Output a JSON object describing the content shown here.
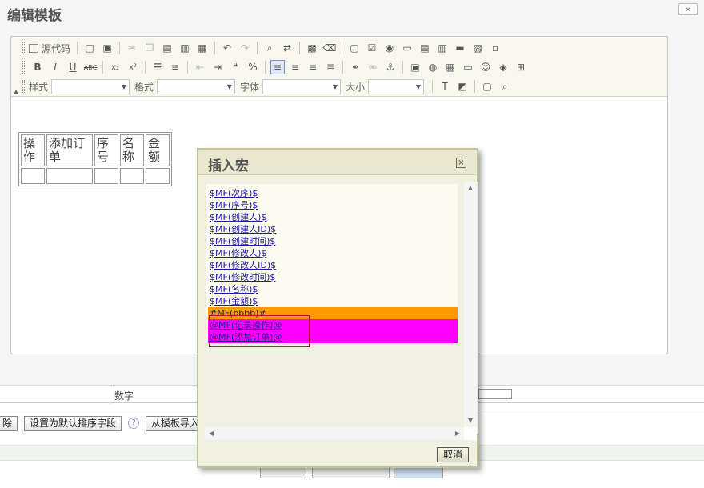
{
  "outer_dialog": {
    "title": "编辑模板",
    "close_icon": "×"
  },
  "toolbar": {
    "source_label": "源代码",
    "style_label": "样式",
    "format_label": "格式",
    "font_label": "字体",
    "size_label": "大小",
    "style_value": "",
    "format_value": "",
    "font_value": "",
    "size_value": ""
  },
  "template_table": {
    "headers": [
      "操作",
      "添加订单",
      "序号",
      "名称",
      "金额"
    ]
  },
  "macro_dialog": {
    "title": "插入宏",
    "items": [
      "$MF(次序)$",
      "$MF(序号)$",
      "$MF(创建人)$",
      "$MF(创建人ID)$",
      "$MF(创建时间)$",
      "$MF(修改人)$",
      "$MF(修改人ID)$",
      "$MF(修改时间)$",
      "$MF(名称)$",
      "$MF(金额)$",
      "#MF(bbbb)#",
      "@MF(记录操作)@",
      "@MF(添加订单)@"
    ],
    "cancel_label": "取消"
  },
  "background": {
    "grid_cell_text": "数字",
    "btn_delete_partial": "除",
    "btn_set_default_sort": "设置为默认排序字段",
    "btn_import_template": "从模板导入",
    "help_icon": "?"
  },
  "colors": {
    "orange_highlight": "#ff9900",
    "magenta_highlight": "#ff00ff",
    "link_blue": "#1a1aa6",
    "focus_red": "#c8102e"
  }
}
